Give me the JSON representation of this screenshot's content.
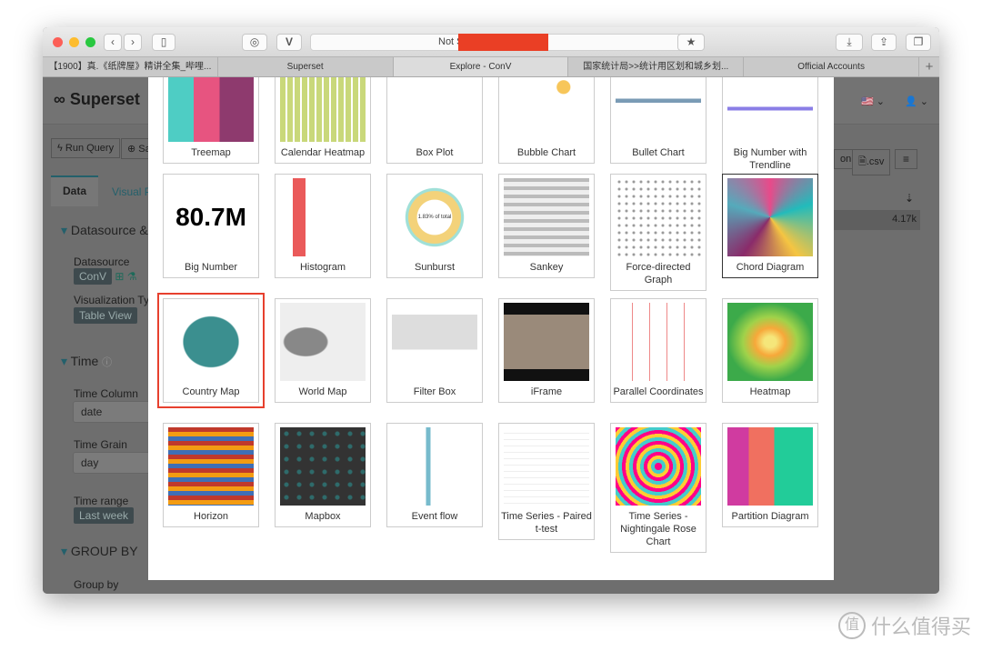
{
  "browser": {
    "url_text": "Not S",
    "tabs": [
      {
        "label": "【1900】真.《纸牌屋》精讲全集_哔哩..."
      },
      {
        "label": "Superset"
      },
      {
        "label": "Explore - ConV",
        "active": true
      },
      {
        "label": "国家统计局>>统计用区划和城乡划..."
      },
      {
        "label": "Official Accounts"
      }
    ],
    "new_tab": "+"
  },
  "app": {
    "brand": "Superset",
    "run_query": "Run Query",
    "save": "Sa",
    "tab_data": "Data",
    "tab_visual": "Visual P",
    "datasource_section": "Datasource &",
    "datasource_label": "Datasource",
    "datasource_value": "ConV",
    "viz_label": "Visualization Ty",
    "viz_value": "Table View",
    "time_section": "Time",
    "time_column_label": "Time Column",
    "time_column_value": "date",
    "time_grain_label": "Time Grain",
    "time_grain_value": "day",
    "time_range_label": "Time range",
    "time_range_value": "Last week",
    "groupby_section": "GROUP BY",
    "groupby_label": "Group by",
    "json_btn": "on",
    "csv_btn": ".csv",
    "cell_value": "4.17k"
  },
  "modal": {
    "items": [
      {
        "label": "Treemap"
      },
      {
        "label": "Calendar Heatmap"
      },
      {
        "label": "Box Plot"
      },
      {
        "label": "Bubble Chart"
      },
      {
        "label": "Bullet Chart"
      },
      {
        "label": "Big Number with Trendline"
      },
      {
        "label": "Big Number",
        "thumb_text": "80.7M"
      },
      {
        "label": "Histogram"
      },
      {
        "label": "Sunburst",
        "thumb_text": "1.83% of total"
      },
      {
        "label": "Sankey"
      },
      {
        "label": "Force-directed Graph"
      },
      {
        "label": "Chord Diagram"
      },
      {
        "label": "Country Map",
        "selected": true
      },
      {
        "label": "World Map"
      },
      {
        "label": "Filter Box"
      },
      {
        "label": "iFrame"
      },
      {
        "label": "Parallel Coordinates"
      },
      {
        "label": "Heatmap"
      },
      {
        "label": "Horizon"
      },
      {
        "label": "Mapbox"
      },
      {
        "label": "Event flow"
      },
      {
        "label": "Time Series - Paired t-test"
      },
      {
        "label": "Time Series - Nightingale Rose Chart"
      },
      {
        "label": "Partition Diagram"
      }
    ]
  },
  "colors": {
    "selected_outline": "#e7402e",
    "accent": "#00a699"
  },
  "watermark": "什么值得买"
}
